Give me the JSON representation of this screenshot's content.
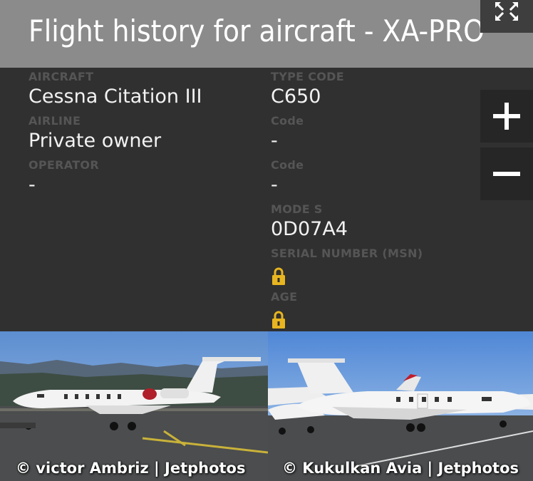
{
  "header": {
    "title": "Flight history for aircraft - XA-PRO"
  },
  "icons": {
    "expand": "expand-arrows-icon",
    "zoom_in": "plus-icon",
    "zoom_out": "minus-icon",
    "lock": "lock-icon"
  },
  "details": {
    "aircraft_label": "AIRCRAFT",
    "aircraft_value": "Cessna Citation III",
    "airline_label": "AIRLINE",
    "airline_value": "Private owner",
    "operator_label": "OPERATOR",
    "operator_value": "-",
    "type_code_label": "TYPE CODE",
    "type_code_value": "C650",
    "airline_code_label": "Code",
    "airline_code_value": "-",
    "operator_code_label": "Code",
    "operator_code_value": "-",
    "mode_s_label": "MODE S",
    "mode_s_value": "0D07A4",
    "serial_label": "SERIAL NUMBER (MSN)",
    "age_label": "AGE"
  },
  "photos": [
    {
      "credit": "© victor Ambriz | Jetphotos"
    },
    {
      "credit": "© Kukulkan Avia | Jetphotos"
    }
  ],
  "colors": {
    "header_bg": "#8b8b8b",
    "panel_bg": "#303030",
    "label": "#555555",
    "value": "#f2f2f2",
    "lock": "#e8b520"
  }
}
